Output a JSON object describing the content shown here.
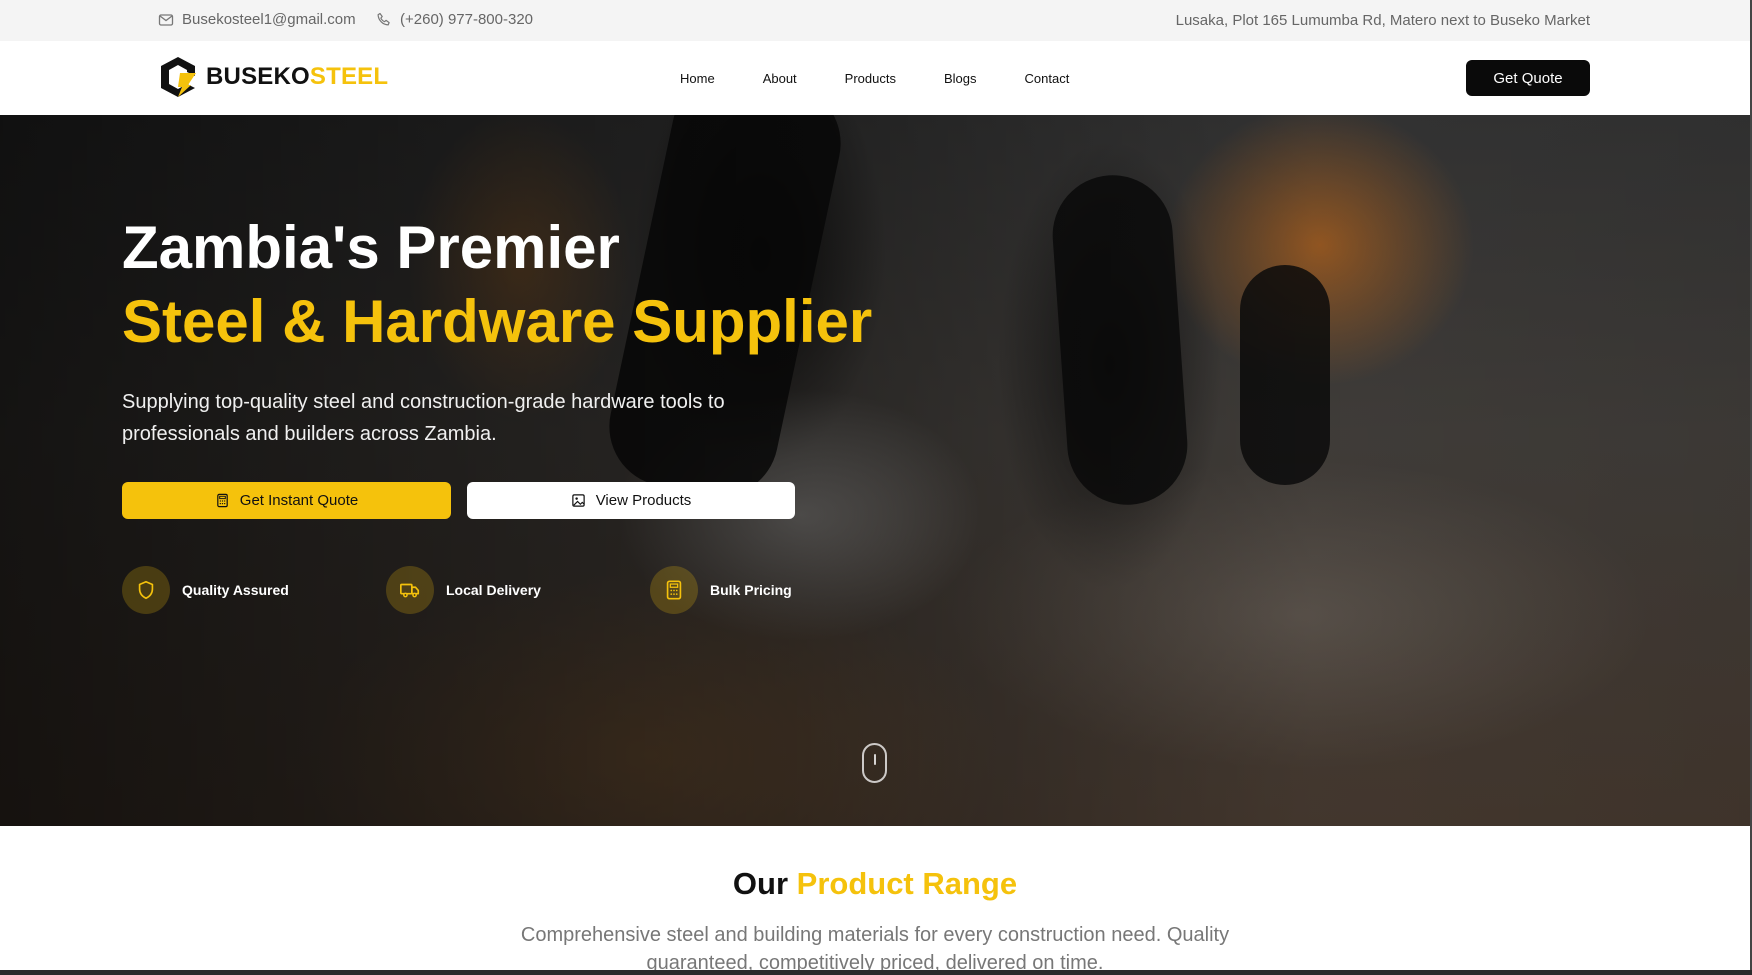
{
  "topbar": {
    "email": "Busekosteel1@gmail.com",
    "phone": "(+260) 977-800-320",
    "address": "Lusaka, Plot 165 Lumumba Rd, Matero next to Buseko Market"
  },
  "brand": {
    "part1": "BUSEKO",
    "part2": "STEEL"
  },
  "nav": {
    "links": [
      "Home",
      "About",
      "Products",
      "Blogs",
      "Contact"
    ],
    "cta": "Get Quote"
  },
  "hero": {
    "title_line1": "Zambia's Premier",
    "title_line2": "Steel & Hardware Supplier",
    "subtitle": "Supplying top-quality steel and construction-grade hardware tools to professionals and builders across Zambia.",
    "primary_button": "Get Instant Quote",
    "secondary_button": "View Products",
    "features": [
      {
        "icon": "shield-icon",
        "label": "Quality Assured"
      },
      {
        "icon": "truck-icon",
        "label": "Local Delivery"
      },
      {
        "icon": "calculator-icon",
        "label": "Bulk Pricing"
      }
    ]
  },
  "products_section": {
    "title_part1": "Our",
    "title_part2": "Product Range",
    "subtitle": "Comprehensive steel and building materials for every construction need. Quality guaranteed, competitively priced, delivered on time."
  },
  "colors": {
    "accent": "#f5c20c",
    "dark": "#0a0a0a",
    "topbar_bg": "#f4f4f4"
  }
}
